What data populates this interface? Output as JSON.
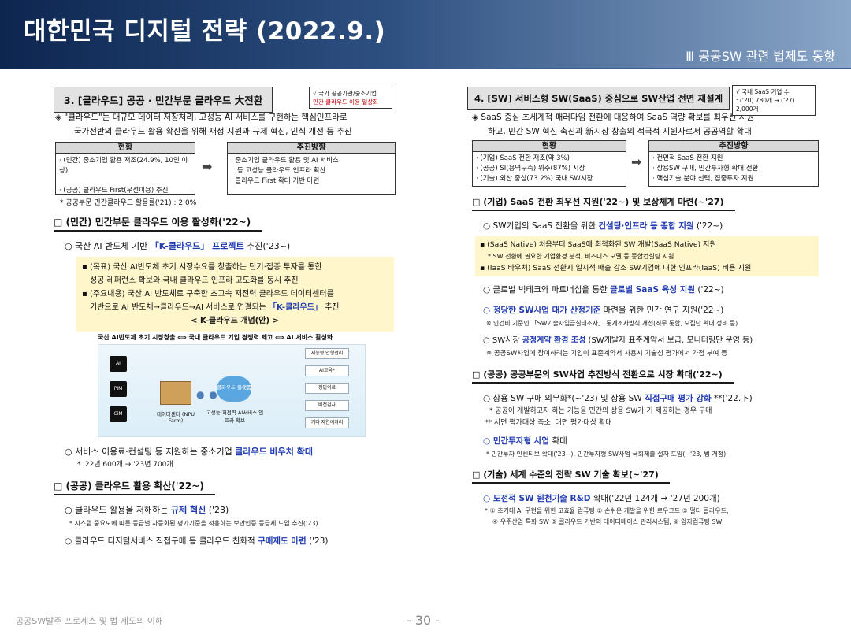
{
  "header": {
    "title": "대한민국 디지털 전략 (2022.9.)",
    "section": "Ⅲ 공공SW 관련 법제도 동향"
  },
  "left": {
    "heading": "3. [클라우드] 공공 · 민간부문 클라우드 大전환",
    "tag_line1": "√ 국가 공공기관/중소기업",
    "tag_line2": "민간 클라우드 이용 일상화",
    "lead_line1": "◈ \"클라우드\"는 대규모 데이터 저장처리, 고성능 AI 서비스를 구현하는 핵심인프라로",
    "lead_line2": "국가전반의 클라우드 활용 확산을 위해 재정 지원과 규제 혁신, 인식 개선 등 추진",
    "status_header": "현황",
    "direction_header": "추진방향",
    "status_line1": "· (민간) 중소기업 활용 저조(24.9%, 10인 이상)",
    "status_line2": "· (공공) 클라우드 First(우선이용) 추진'",
    "direction_line1": "· 중소기업 클라우드 활용 및 AI 서비스",
    "direction_line2": "등 고성능 클라우드 인프라 확산",
    "direction_line3": "· 클라우드 First 확대 기반 마련",
    "note": "* 공공부문 민간클라우드 활용률('21) : 2.0%",
    "sub1": "□ (민간) 민간부문 클라우드 이용 활성화('22~)",
    "item1_pre": "○ 국산 AI 반도체 기반",
    "item1_bold": "「K-클라우드」 프로젝트",
    "item1_post": "추진('23~)",
    "y1_line1": "▪ (목표) 국산 AI반도체 초기 시장수요를 창출하는 단기·집중 투자를 통한",
    "y1_line2": "성공 레퍼런스 확보와 국내 클라우드 인프라 고도화를 동시 추진",
    "y1_line3": "▪ (주요내용) 국산 AI 반도체로 구축한 초고속 저전력 클라우드 데이터센터를",
    "y1_line4_pre": "기반으로 AI 반도체→클라우드→AI 서비스로 연결되는",
    "y1_line4_bold": "「K-클라우드」",
    "y1_line4_post": "추진",
    "concept": "< K-클라우드 개념(안) >",
    "diag_top": "국산 AI반도체 초기 시장창출 ⟺ 국내 클라우드 기업 경쟁력 제고 ⟺ AI 서비스 활성화",
    "chip1": "AI",
    "chip2": "PIM",
    "chip3": "CiM",
    "server_label": "데이터센터 (NPU Farm)",
    "cloud_label": "클라우드 플랫폼",
    "cloud_sub": "고성능·저전력 AI서비스 인프라 확보",
    "svc1": "지능형 안행관리",
    "svc2": "AI교육*",
    "svc3": "정밀의료",
    "svc4": "비전검사",
    "svc5": "기타 자연어처리",
    "item2_pre": "○ 서비스 이용료·컨설팅 등 지원하는 중소기업",
    "item2_bold": "클라우드 바우처 확대",
    "item2_note": "* '22년 600개 → '23년 700개",
    "sub2": "□ (공공) 클라우드 활용 확산('22~)",
    "item3_pre": "○ 클라우드 활용을 저해하는",
    "item3_bold": "규제 혁신",
    "item3_post": "('23)",
    "item3_note": "* 시스템 중요도에 따른 등급별 차등화된 평가기준을 적용하는 보안인증 등급제 도입 추진('23)",
    "item4_pre": "○ 클라우드 디지털서비스 직접구매 등 클라우드 친화적",
    "item4_bold": "구매제도 마련",
    "item4_post": "('23)"
  },
  "right": {
    "heading": "4. [SW] 서비스형 SW(SaaS) 중심으로 SW산업 전면 재설계",
    "tag_line1": "√ 국내 SaaS 기업 수",
    "tag_line2": ": ('20) 780개 → ('27) 2,000개",
    "lead_line1": "◈ SaaS 중심 초세계적 패러다임 전환에 대응하여 SaaS 역량 확보를 최우선 지원",
    "lead_line2": "하고, 민간 SW 혁신 촉진과 新시장 창출의 적극적 지원자로서 공공역할 확대",
    "status_header": "현황",
    "direction_header": "추진방향",
    "status_line1": "· (기업) SaaS 전환 저조(약 3%)",
    "status_line2": "· (공공) SI(용역구축) 위주(87%) 시장",
    "status_line3": "· (기술) 외산 중심(73.2%) 국내 SW시장",
    "direction_line1": "· 전면적 SaaS 전환 지원",
    "direction_line2": "· 상용SW 구매, 민간투자형 확대·전환",
    "direction_line3": "· 핵심기술 분야 선택, 집중투자 지원",
    "sub1": "□ (기업) SaaS 전환 최우선 지원('22~) 및 보상체계 마련(~'27)",
    "item1_pre": "○ SW기업의 SaaS 전환을 위한",
    "item1_bold": "컨설팅·인프라 등 종합 지원",
    "item1_post": "('22~)",
    "y1": "▪ (SaaS Native) 처음부터 SaaS에 최적화된 SW 개발(SaaS Native) 지원",
    "y2": "* SW 전환에 필요한 기업환경 분석, 비즈니스 모델 등 종합컨설팅 지원",
    "y3": "▪ (IaaS 바우처) SaaS 전환시 일시적 매출 감소 SW기업에 대한 인프라(IaaS) 비용 지원",
    "item2_pre": "○ 글로벌 빅테크와 파트너십을 통한",
    "item2_bold": "글로벌 SaaS 육성 지원",
    "item2_post": "('22~)",
    "item3_bold": "○ 정당한 SW사업 대가 산정기준",
    "item3_post": "마련을 위한 민간 연구 지원('22~)",
    "item3_note": "※ 인건비 기준인 「SW기술자임금실태조사」 통계조사방식 개선(직무 통합, 모집단 확대 정비 등)",
    "item4_pre": "○ SW시장",
    "item4_bold": "공정계약 환경 조성",
    "item4_post": "(SW개발자 표준계약서 보급, 모니터링단 운영 등)",
    "item4_note": "※ 공공SW사업에 참여하려는 기업이 표준계약서 사용시 기술성 평가에서 가점 부여 등",
    "sub2": "□ (공공) 공공부문의 SW사업 추진방식 전환으로 시장 확대('22~)",
    "item5_pre": "○ 상용 SW 구매 의무화*(~'23) 및 상용 SW",
    "item5_bold": "직접구매 평가 강화",
    "item5_post": "**('22.下)",
    "item5_note1": "* 공공이 개발하고자 하는 기능을 민간의 상용 SW가 기 제공하는 경우 구매",
    "item5_note2": "** 서면 평가대상 축소, 대면 평가대상 확대",
    "item6_bold": "○ 민간투자형 사업",
    "item6_post": "확대",
    "item6_note": "* 민간투자 인센티브 확대('23~), 민간투자형 SW사업 국회제출 절차 도입(~'23, 법 개정)",
    "sub3": "□ (기술) 세계 수준의 전략 SW 기술 확보(~'27)",
    "item7_bold": "○ 도전적 SW 원천기술 R&D",
    "item7_post": "확대('22년 124개 → '27년 200개)",
    "item7_note1": "* ① 초거대 AI 구현을 위한 고효율 컴퓨팅 ② 손쉬운 개발을 위한 로우코드 ③ 멀티 클라우드,",
    "item7_note2": "④ 우주산업 특화 SW ⑤ 클라우드 기반의 데이터베이스 관리시스템, ⑥ 양자컴퓨팅 SW"
  },
  "footer": {
    "left": "공공SW발주 프로세스 및 법·제도의 이해",
    "page": "- 30 -"
  }
}
